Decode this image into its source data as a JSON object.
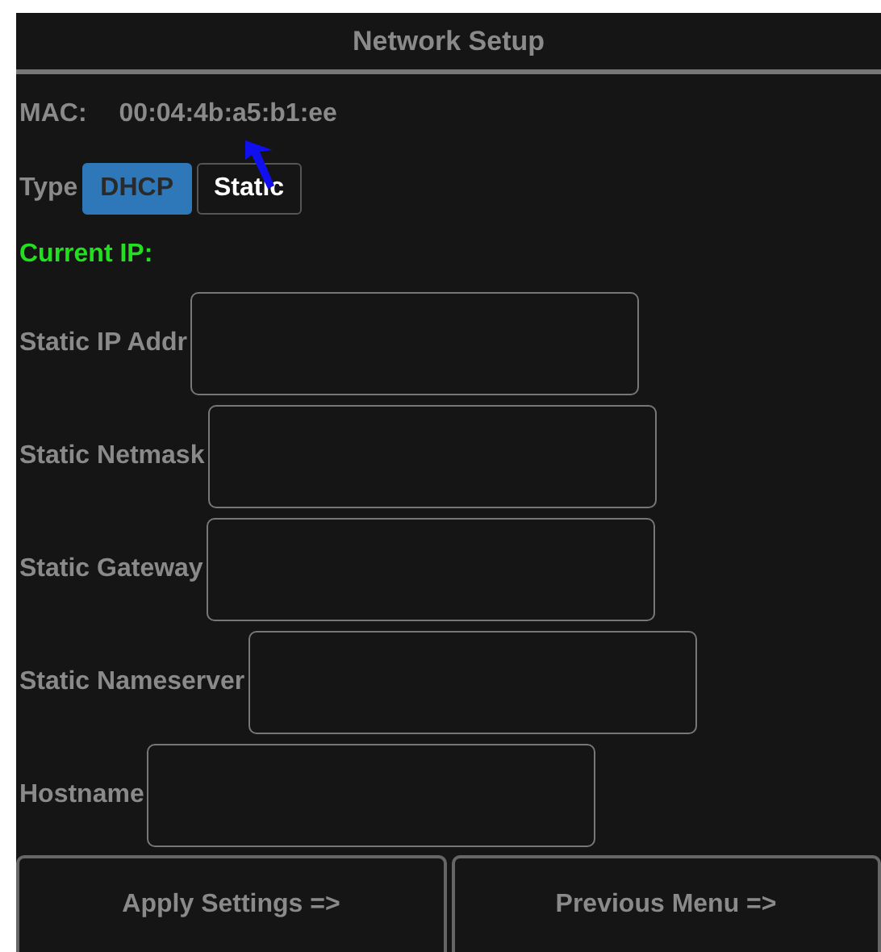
{
  "window": {
    "title": "Network Setup"
  },
  "mac": {
    "label": "MAC:",
    "value": "00:04:4b:a5:b1:ee"
  },
  "type": {
    "label": "Type",
    "options": [
      {
        "label": "DHCP",
        "selected": true
      },
      {
        "label": "Static",
        "selected": false
      }
    ]
  },
  "current_ip": {
    "label": "Current IP:"
  },
  "fields": [
    {
      "label": "Static IP Addr"
    },
    {
      "label": "Static Netmask"
    },
    {
      "label": "Static Gateway"
    },
    {
      "label": "Static Nameserver"
    },
    {
      "label": "Hostname"
    }
  ],
  "buttons": [
    {
      "label": "Apply Settings =>"
    },
    {
      "label": "Previous Menu =>"
    }
  ]
}
